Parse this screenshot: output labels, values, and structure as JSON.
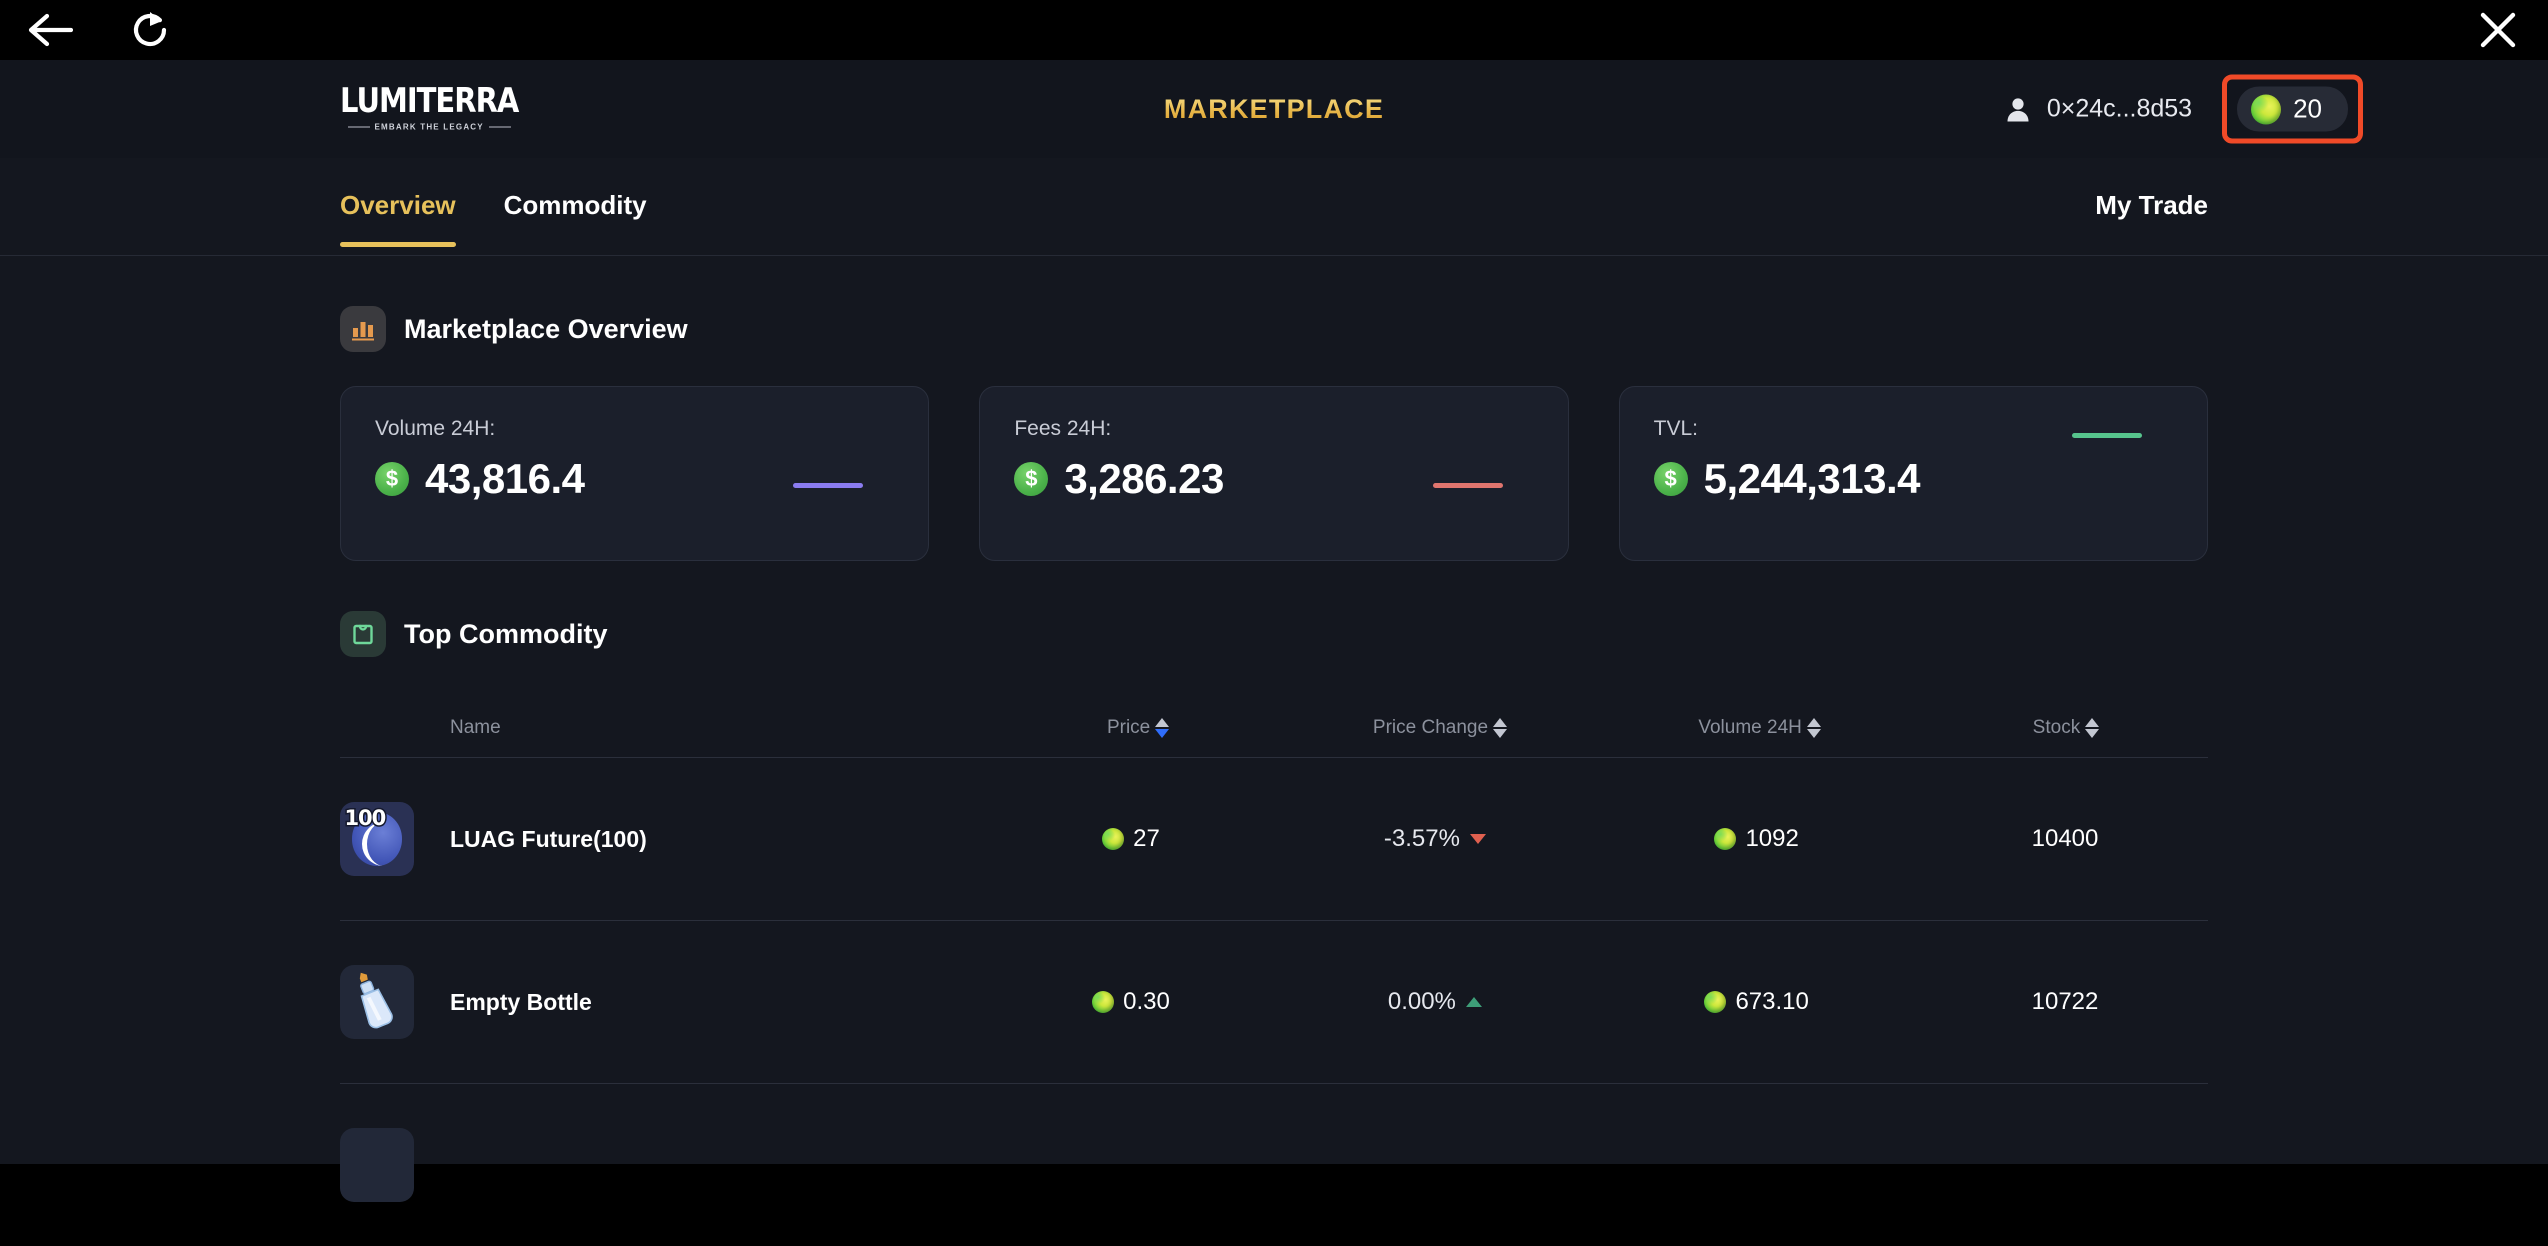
{
  "chrome": {
    "back_icon": "arrow-left-icon",
    "reload_icon": "reload-icon",
    "close_icon": "close-icon"
  },
  "header": {
    "logo_text": "LUMITERRA",
    "logo_tagline": "EMBARK THE LEGACY",
    "title": "MARKETPLACE",
    "account_address": "0×24c...8d53",
    "account_icon": "user-icon",
    "balance_value": "20",
    "balance_icon": "lumi-coin-icon",
    "highlight_color": "#f04a28"
  },
  "tabs": {
    "items": [
      {
        "label": "Overview",
        "active": true
      },
      {
        "label": "Commodity",
        "active": false
      }
    ],
    "right_label": "My Trade"
  },
  "overview": {
    "section_title": "Marketplace Overview",
    "section_icon": "bar-chart-icon",
    "cards": [
      {
        "label": "Volume 24H:",
        "value": "43,816.4",
        "icon": "dollar-coin-icon",
        "trend_color": "#8b7cf0"
      },
      {
        "label": "Fees 24H:",
        "value": "3,286.23",
        "icon": "dollar-coin-icon",
        "trend_color": "#e0756e"
      },
      {
        "label": "TVL:",
        "value": "5,244,313.4",
        "icon": "dollar-coin-icon",
        "trend_color": "#57c48d"
      }
    ]
  },
  "top_commodity": {
    "section_title": "Top Commodity",
    "section_icon": "shopping-bag-icon",
    "columns": [
      {
        "label": "Name",
        "sortable": false,
        "sort_state": "none"
      },
      {
        "label": "Price",
        "sortable": true,
        "sort_state": "desc"
      },
      {
        "label": "Price Change",
        "sortable": true,
        "sort_state": "none"
      },
      {
        "label": "Volume 24H",
        "sortable": true,
        "sort_state": "none"
      },
      {
        "label": "Stock",
        "sortable": true,
        "sort_state": "none"
      }
    ],
    "rows": [
      {
        "icon": "moon-100-item-icon",
        "icon_badge": "100",
        "name": "LUAG Future(100)",
        "price": "27",
        "price_change": "-3.57%",
        "change_direction": "down",
        "volume_24h": "1092",
        "stock": "10400"
      },
      {
        "icon": "empty-bottle-item-icon",
        "icon_badge": "",
        "name": "Empty Bottle",
        "price": "0.30",
        "price_change": "0.00%",
        "change_direction": "up",
        "volume_24h": "673.10",
        "stock": "10722"
      }
    ]
  }
}
